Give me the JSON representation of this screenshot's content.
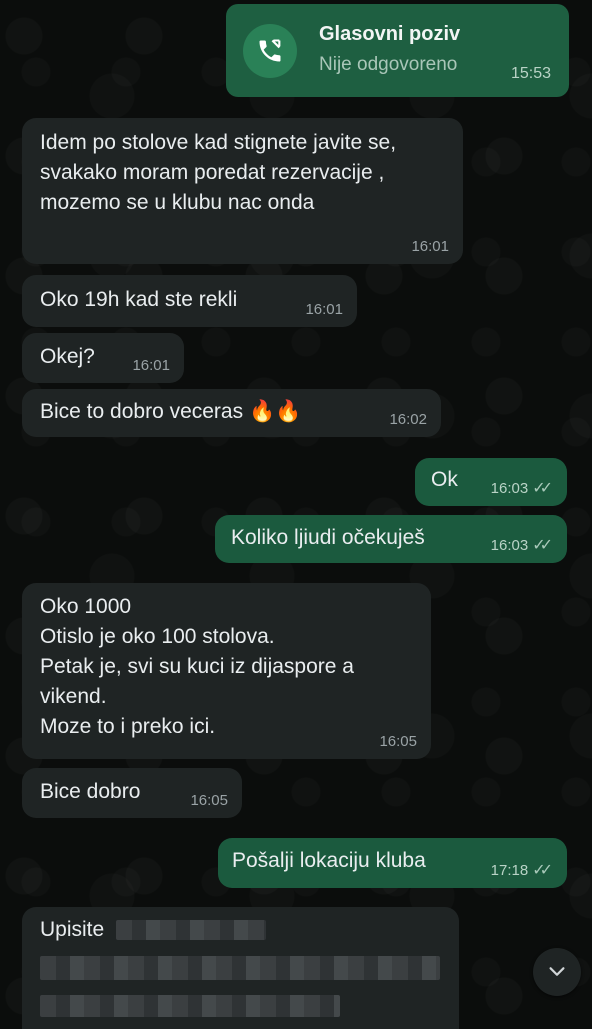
{
  "call": {
    "title": "Glasovni poziv",
    "status": "Nije odgovoreno",
    "time": "15:53",
    "icon": "missed-call-icon"
  },
  "messages": [
    {
      "text": "Idem po stolove kad stignete javite se, svakako moram poredat rezervacije , mozemo se u klubu nac onda",
      "time": "16:01"
    },
    {
      "text": "Oko 19h kad ste rekli",
      "time": "16:01"
    },
    {
      "text": "Okej?",
      "time": "16:01"
    },
    {
      "text": "Bice to dobro veceras 🔥🔥",
      "time": "16:02"
    },
    {
      "text": "Ok",
      "time": "16:03",
      "status": "read"
    },
    {
      "text": "Koliko ljiudi očekuješ",
      "time": "16:03",
      "status": "read"
    },
    {
      "text": "Oko 1000\nOtislo je oko 100 stolova.\nPetak je, svi su kuci iz dijaspore a vikend.\nMoze to i preko ici.",
      "time": "16:05"
    },
    {
      "text": "Bice dobro",
      "time": "16:05"
    },
    {
      "text": "Pošalji lokaciju kluba",
      "time": "17:18",
      "status": "read"
    },
    {
      "text": "Upisite",
      "redacted": true
    }
  ],
  "ticks_glyph": "✓✓",
  "scroll_button": {
    "icon": "chevron-down-icon"
  },
  "colors": {
    "incoming": "#1f2424",
    "outgoing": "#1b5a3e",
    "background": "#0b0d0c"
  }
}
